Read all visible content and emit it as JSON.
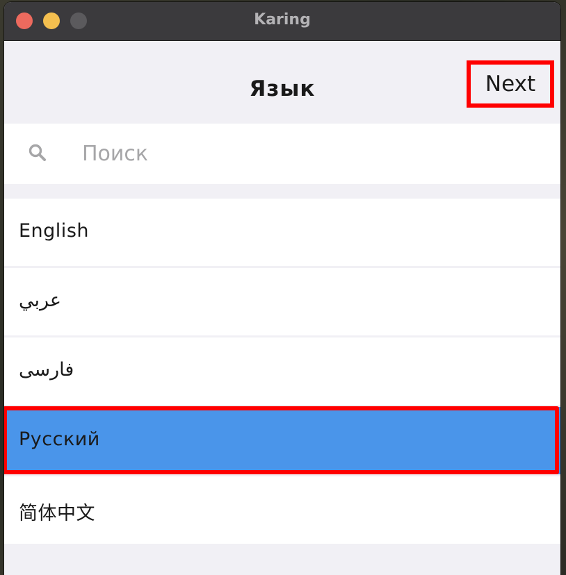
{
  "window": {
    "title": "Karing"
  },
  "header": {
    "title": "Язык",
    "next_label": "Next"
  },
  "search": {
    "placeholder": "Поиск",
    "value": ""
  },
  "languages": [
    {
      "label": "English",
      "selected": false
    },
    {
      "label": "عربي",
      "selected": false
    },
    {
      "label": "فارسی",
      "selected": false
    },
    {
      "label": "Русский",
      "selected": true
    },
    {
      "label": "简体中文",
      "selected": false
    }
  ],
  "colors": {
    "selection": "#4a95ea",
    "highlight_box": "#ff0000",
    "background": "#f1f0f5"
  },
  "icons": {
    "search": "search-icon"
  }
}
